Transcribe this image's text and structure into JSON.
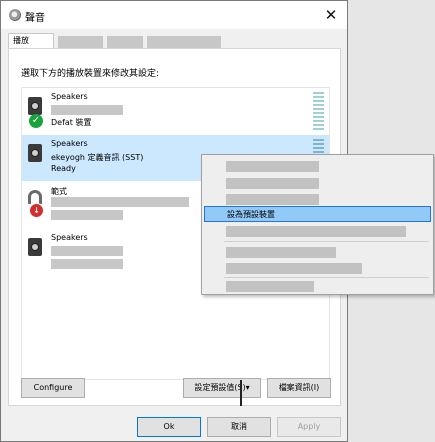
{
  "window": {
    "title": "聲音"
  },
  "tabs": {
    "active": "播放"
  },
  "panel": {
    "instruction": "選取下方的播放裝置來修改其設定:"
  },
  "devices": [
    {
      "name": "Speakers",
      "status": "Defat 裝置",
      "icon": "speaker-icon",
      "badge": "check-icon"
    },
    {
      "name": "Speakers",
      "description": "ekeyogh 定義音訊 (SST)",
      "status": "Ready",
      "icon": "speaker-icon"
    },
    {
      "name": "範式",
      "icon": "headset-icon",
      "badge": "down-arrow-icon"
    },
    {
      "name": "Speakers",
      "icon": "speaker-icon"
    }
  ],
  "buttons": {
    "configure": "Configure",
    "set_default": "設定預設值(S)▾",
    "properties": "檔案資訊(I)",
    "ok": "Ok",
    "cancel": "取消",
    "apply": "Apply"
  },
  "context_menu": {
    "highlighted_item": "設為預設裝置"
  },
  "colors": {
    "selection": "#cce8ff",
    "highlight": "#91c9f7",
    "accent": "#0078d7"
  }
}
